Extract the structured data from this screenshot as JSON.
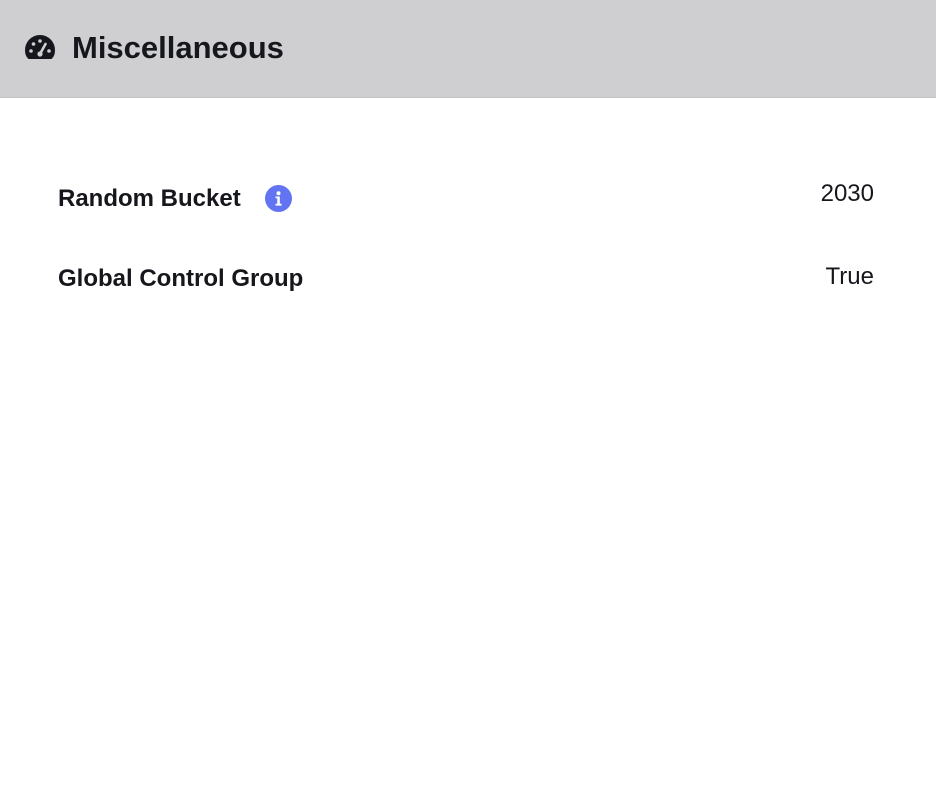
{
  "header": {
    "icon": "speedometer-icon",
    "title": "Miscellaneous",
    "background": "#cfcfd1"
  },
  "rows": [
    {
      "label": "Random Bucket",
      "info_icon": "info-icon",
      "value": "2030"
    },
    {
      "label": "Global Control Group",
      "value": "True"
    }
  ],
  "colors": {
    "text": "#16171c",
    "info_accent": "#6274f2"
  }
}
